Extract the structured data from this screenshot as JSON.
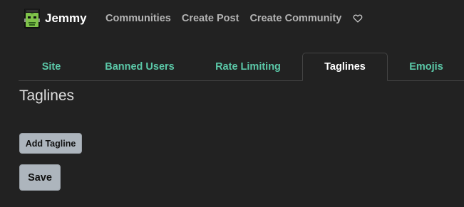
{
  "navbar": {
    "brand_name": "Jemmy",
    "links": [
      "Communities",
      "Create Post",
      "Create Community"
    ],
    "logo_icon": "frankenstein-icon",
    "heart_icon": "heart-outline-icon"
  },
  "tabs": [
    {
      "label": "Site",
      "active": false
    },
    {
      "label": "Banned Users",
      "active": false
    },
    {
      "label": "Rate Limiting",
      "active": false
    },
    {
      "label": "Taglines",
      "active": true
    },
    {
      "label": "Emojis",
      "active": false
    }
  ],
  "main": {
    "title": "Taglines",
    "add_button": "Add Tagline",
    "save_button": "Save"
  },
  "colors": {
    "background": "#222222",
    "tab_accent": "#5bc8a8",
    "button_bg": "#adb5bd"
  }
}
